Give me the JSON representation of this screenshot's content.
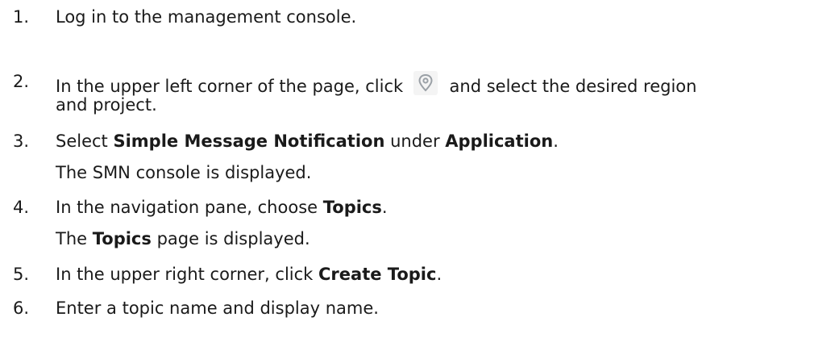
{
  "steps": [
    {
      "number": "1.",
      "text": "Log in to the management console."
    },
    {
      "number": "2.",
      "text_before": "In the upper left corner of the page, click",
      "icon": "location-pin-icon",
      "text_after": "and select the desired region",
      "continuation": "and project."
    },
    {
      "number": "3.",
      "pre": "Select ",
      "bold1": "Simple Message Notification",
      "mid": " under ",
      "bold2": "Application",
      "post": ".",
      "result": "The SMN console is displayed."
    },
    {
      "number": "4.",
      "pre": "In the navigation pane, choose ",
      "bold": "Topics",
      "post": ".",
      "result_pre": "The ",
      "result_bold": "Topics",
      "result_post": " page is displayed."
    },
    {
      "number": "5.",
      "pre": "In the upper right corner, click ",
      "bold": "Create Topic",
      "post": "."
    },
    {
      "number": "6.",
      "text": "Enter a topic name and display name."
    }
  ],
  "colors": {
    "text": "#1a1a1a",
    "icon_bg": "#f2f2f2",
    "icon_stroke": "#9aa0a6"
  }
}
